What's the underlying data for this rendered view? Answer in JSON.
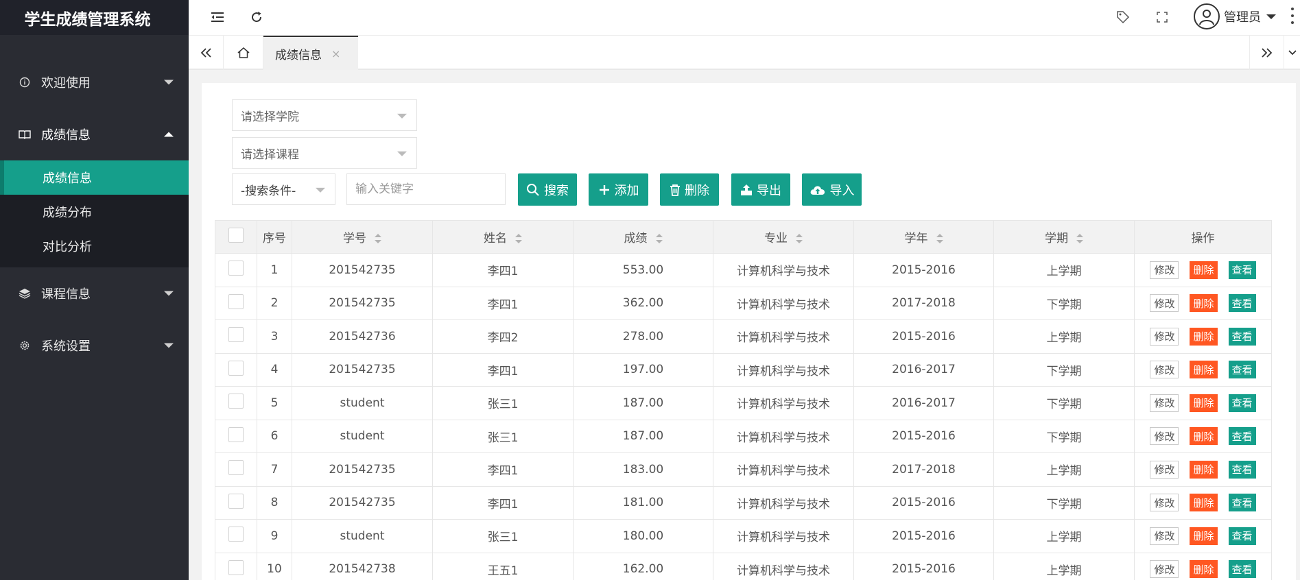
{
  "app": {
    "title": "学生成绩管理系统"
  },
  "sidebar": {
    "items": [
      {
        "label": "欢迎使用",
        "icon": "info-icon"
      },
      {
        "label": "成绩信息",
        "icon": "book-icon",
        "open": true,
        "children": [
          {
            "label": "成绩信息",
            "active": true
          },
          {
            "label": "成绩分布"
          },
          {
            "label": "对比分析"
          }
        ]
      },
      {
        "label": "课程信息",
        "icon": "layers-icon"
      },
      {
        "label": "系统设置",
        "icon": "gear-icon"
      }
    ]
  },
  "topbar": {
    "user": "管理员"
  },
  "tabs": {
    "active": "成绩信息",
    "close": "×"
  },
  "filters": {
    "college_placeholder": "请选择学院",
    "course_placeholder": "请选择课程",
    "condition": "-搜索条件-",
    "keyword_placeholder": "输入关键字"
  },
  "buttons": {
    "search": "搜索",
    "add": "添加",
    "delete": "删除",
    "export": "导出",
    "import": "导入"
  },
  "table": {
    "headers": {
      "index": "序号",
      "sid": "学号",
      "name": "姓名",
      "score": "成绩",
      "major": "专业",
      "year": "学年",
      "term": "学期",
      "ops": "操作"
    },
    "ops": {
      "edit": "修改",
      "del": "删除",
      "view": "查看"
    },
    "rows": [
      {
        "index": "1",
        "sid": "201542735",
        "name": "李四1",
        "score": "553.00",
        "major": "计算机科学与技术",
        "year": "2015-2016",
        "term": "上学期"
      },
      {
        "index": "2",
        "sid": "201542735",
        "name": "李四1",
        "score": "362.00",
        "major": "计算机科学与技术",
        "year": "2017-2018",
        "term": "下学期"
      },
      {
        "index": "3",
        "sid": "201542736",
        "name": "李四2",
        "score": "278.00",
        "major": "计算机科学与技术",
        "year": "2015-2016",
        "term": "上学期"
      },
      {
        "index": "4",
        "sid": "201542735",
        "name": "李四1",
        "score": "197.00",
        "major": "计算机科学与技术",
        "year": "2016-2017",
        "term": "下学期"
      },
      {
        "index": "5",
        "sid": "student",
        "name": "张三1",
        "score": "187.00",
        "major": "计算机科学与技术",
        "year": "2016-2017",
        "term": "下学期"
      },
      {
        "index": "6",
        "sid": "student",
        "name": "张三1",
        "score": "187.00",
        "major": "计算机科学与技术",
        "year": "2015-2016",
        "term": "下学期"
      },
      {
        "index": "7",
        "sid": "201542735",
        "name": "李四1",
        "score": "183.00",
        "major": "计算机科学与技术",
        "year": "2017-2018",
        "term": "上学期"
      },
      {
        "index": "8",
        "sid": "201542735",
        "name": "李四1",
        "score": "181.00",
        "major": "计算机科学与技术",
        "year": "2015-2016",
        "term": "下学期"
      },
      {
        "index": "9",
        "sid": "student",
        "name": "张三1",
        "score": "180.00",
        "major": "计算机科学与技术",
        "year": "2015-2016",
        "term": "上学期"
      },
      {
        "index": "10",
        "sid": "201542738",
        "name": "王五1",
        "score": "162.00",
        "major": "计算机科学与技术",
        "year": "2015-2016",
        "term": "上学期"
      }
    ]
  },
  "colors": {
    "accent": "#159f8b",
    "danger": "#ff5722",
    "sidebar": "#2a2c33"
  }
}
